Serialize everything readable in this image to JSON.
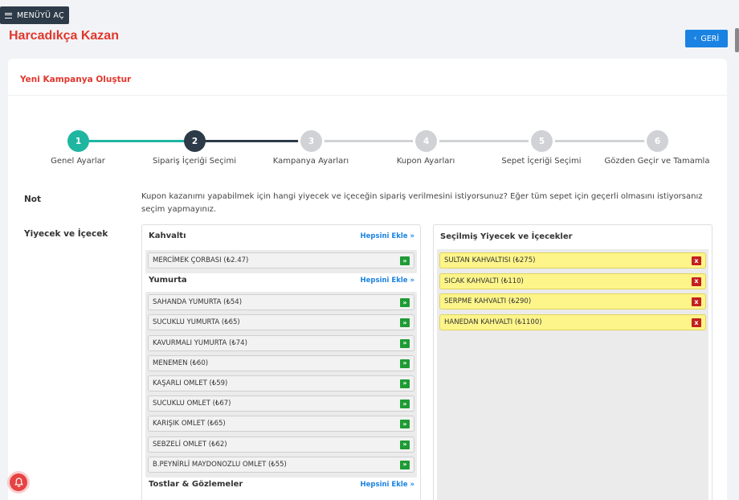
{
  "menu": {
    "label": "MENÜYÜ AÇ"
  },
  "header": {
    "title": "Harcadıkça Kazan",
    "back_label": "GERİ"
  },
  "card": {
    "title": "Yeni Kampanya Oluştur"
  },
  "steps": [
    {
      "number": "1",
      "label": "Genel Ayarlar",
      "state": "done"
    },
    {
      "number": "2",
      "label": "Sipariş İçeriği Seçimi",
      "state": "active"
    },
    {
      "number": "3",
      "label": "Kampanya Ayarları",
      "state": "pending"
    },
    {
      "number": "4",
      "label": "Kupon Ayarları",
      "state": "pending"
    },
    {
      "number": "5",
      "label": "Sepet İçeriği Seçimi",
      "state": "pending"
    },
    {
      "number": "6",
      "label": "Gözden Geçir ve Tamamla",
      "state": "pending"
    }
  ],
  "colors": {
    "done": "#1fb6a1",
    "active": "#2d3a48",
    "pending": "#d0d2d6",
    "accent": "#e0372d",
    "link": "#1a82e2"
  },
  "note": {
    "label": "Not",
    "text": "Kupon kazanımı yapabilmek için hangi yiyecek ve içeceğin sipariş verilmesini istiyorsunuz? Eğer tüm sepet için geçerli olmasını istiyorsanız seçim yapmayınız."
  },
  "food": {
    "label": "Yiyecek ve İçecek",
    "add_all": "Hepsini Ekle »",
    "categories": [
      {
        "name": "Kahvaltı",
        "items": [
          "MERCİMEK ÇORBASI (₺2.47)"
        ]
      },
      {
        "name": "Yumurta",
        "items": [
          "SAHANDA YUMURTA (₺54)",
          "SUCUKLU YUMURTA (₺65)",
          "KAVURMALI YUMURTA (₺74)",
          "MENEMEN (₺60)",
          "KAŞARLI OMLET (₺59)",
          "SUCUKLU OMLET (₺67)",
          "KARIŞIK OMLET (₺65)",
          "SEBZELİ OMLET (₺62)",
          "B.PEYNİRLİ MAYDONOZLU OMLET (₺55)"
        ]
      },
      {
        "name": "Tostlar & Gözlemeler",
        "items": []
      }
    ],
    "add_icon": "»"
  },
  "selected": {
    "title": "Seçilmiş Yiyecek ve İçecekler",
    "items": [
      "SULTAN KAHVALTISI (₺275)",
      "SICAK KAHVALTI (₺110)",
      "SERPME KAHVALTI (₺290)",
      "HANEDAN KAHVALTI (₺1100)"
    ],
    "remove_icon": "x"
  }
}
